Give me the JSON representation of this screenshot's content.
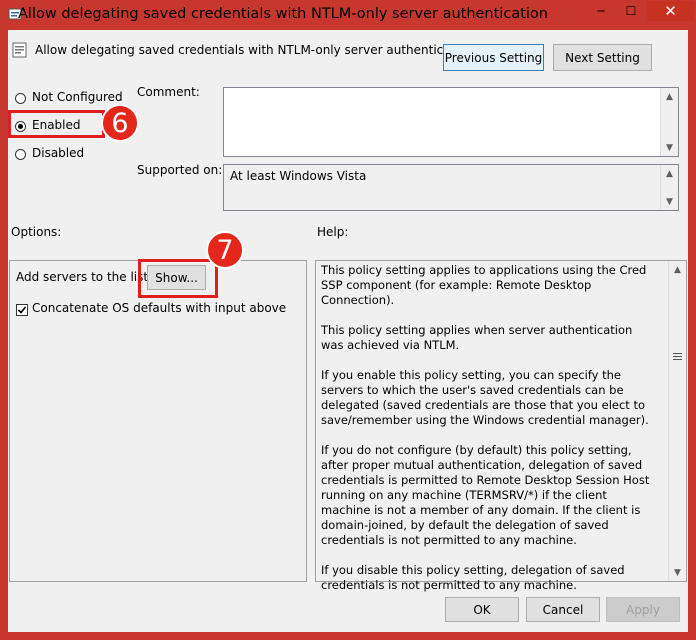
{
  "window": {
    "title": "Allow delegating saved credentials with NTLM-only server authentication",
    "min_glyph": "─",
    "max_glyph": "☐",
    "close_glyph": "✕",
    "accent_color": "#c8372d"
  },
  "header": {
    "setting_name": "Allow delegating saved credentials with NTLM-only server authentication",
    "previous_label": "Previous Setting",
    "next_label": "Next Setting"
  },
  "state": {
    "options": [
      {
        "label": "Not Configured",
        "selected": false
      },
      {
        "label": "Enabled",
        "selected": true
      },
      {
        "label": "Disabled",
        "selected": false
      }
    ]
  },
  "comment": {
    "label": "Comment:",
    "value": ""
  },
  "supported": {
    "label": "Supported on:",
    "value": "At least Windows Vista"
  },
  "options_panel": {
    "heading": "Options:",
    "servers_label": "Add servers to the list:",
    "show_label": "Show...",
    "concat_label": "Concatenate OS defaults with input above",
    "concat_checked": true
  },
  "help": {
    "heading": "Help:",
    "paragraphs": [
      "This policy setting applies to applications using the Cred SSP component (for example: Remote Desktop Connection).",
      "This policy setting applies when server authentication was achieved via NTLM.",
      "If you enable this policy setting, you can specify the servers to which the user's saved credentials can be delegated (saved credentials are those that you elect to save/remember using the Windows credential manager).",
      "If you do not configure (by default) this policy setting, after proper mutual authentication, delegation of saved credentials is permitted to Remote Desktop Session Host running on any machine (TERMSRV/*) if the client machine is not a member of any domain. If the client is domain-joined, by default the delegation of saved credentials is not permitted to any machine.",
      "If you disable this policy setting, delegation of saved credentials is not permitted to any machine."
    ]
  },
  "footer": {
    "ok_label": "OK",
    "cancel_label": "Cancel",
    "apply_label": "Apply"
  },
  "callouts": {
    "step6": "6",
    "step7": "7",
    "color": "#e5261b"
  }
}
